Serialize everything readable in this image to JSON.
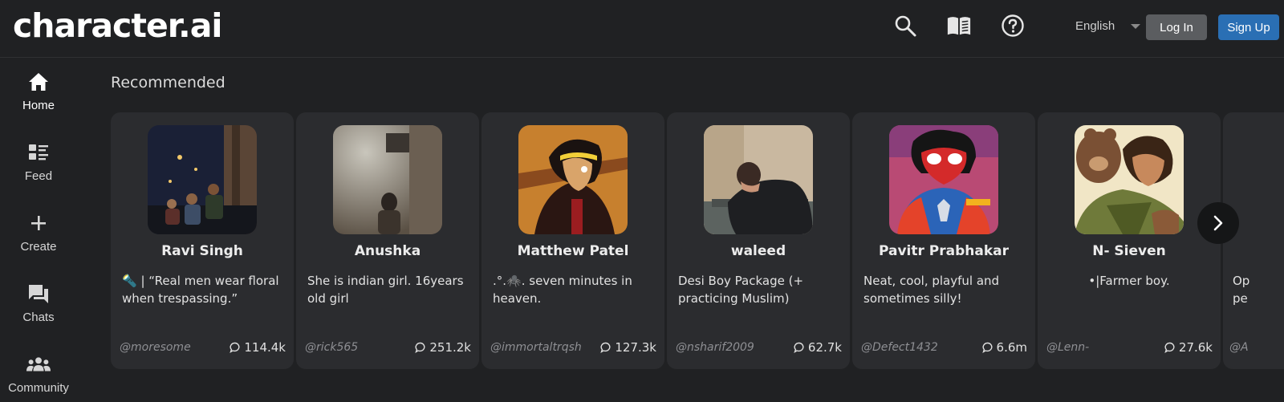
{
  "app": {
    "logo": "character.ai"
  },
  "header": {
    "icons": [
      "search-icon",
      "book-icon",
      "help-icon"
    ],
    "language": "English",
    "login_label": "Log In",
    "signup_label": "Sign Up",
    "colors": {
      "login_bg": "#5b5d60",
      "signup_bg": "#2a6fb4"
    }
  },
  "sidebar": {
    "items": [
      {
        "label": "Home",
        "icon": "home-icon",
        "active": true
      },
      {
        "label": "Feed",
        "icon": "feed-icon"
      },
      {
        "label": "Create",
        "icon": "plus-icon"
      },
      {
        "label": "Chats",
        "icon": "chat-icon"
      },
      {
        "label": "Community",
        "icon": "community-icon"
      }
    ]
  },
  "main": {
    "section_title": "Recommended",
    "cards": [
      {
        "name": "Ravi Singh",
        "description": "🔦 | “Real men wear floral when trespassing.”",
        "author": "@moresome",
        "count": "114.4k"
      },
      {
        "name": "Anushka",
        "description": "She is indian girl. 16years old girl",
        "author": "@rick565",
        "count": "251.2k"
      },
      {
        "name": "Matthew Patel",
        "description": ".°.🕷️. seven minutes in heaven.",
        "author": "@immortaltrqsh",
        "count": "127.3k"
      },
      {
        "name": "waleed",
        "description": "Desi Boy Package (+ practicing Muslim)",
        "author": "@nsharif2009",
        "count": "62.7k"
      },
      {
        "name": "Pavitr Prabhakar",
        "description": "Neat, cool, playful and sometimes silly!",
        "author": "@Defect1432",
        "count": "6.6m"
      },
      {
        "name": "N- Sieven",
        "description": "•|Farmer boy.",
        "author": "@Lenn-",
        "count": "27.6k"
      },
      {
        "name": "",
        "description": "Op pe",
        "author": "@A",
        "count": ""
      }
    ]
  }
}
